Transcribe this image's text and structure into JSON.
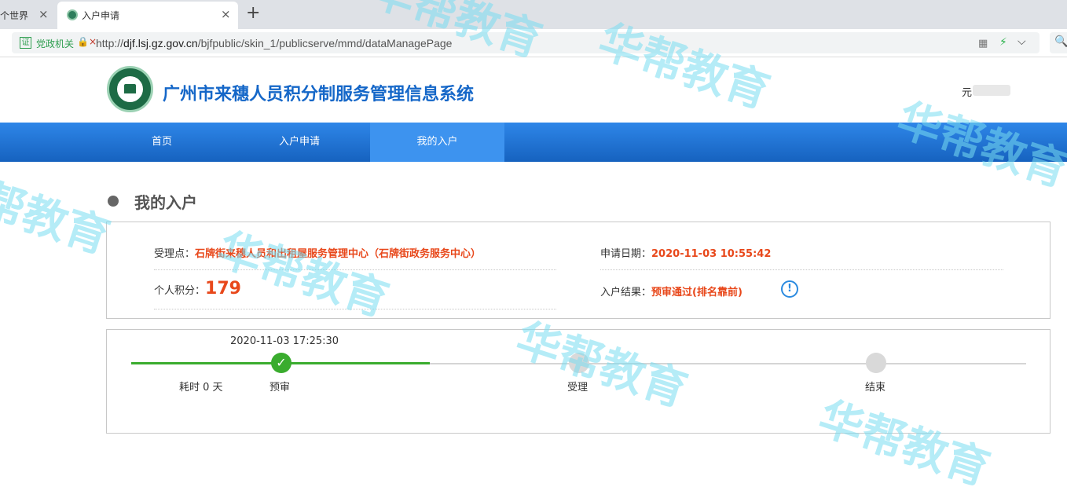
{
  "browser": {
    "tab_prev_title": "个世界",
    "tab_active_title": "入户申请",
    "new_tab": "+",
    "close_glyph": "×",
    "cert_label": "证",
    "cert_text": "党政机关",
    "url_pre": "http://",
    "url_host": "djf.lsj.gz.gov.cn",
    "url_path": "/bjfpublic/skin_1/publicserve/mmd/dataManagePage"
  },
  "header": {
    "title": "广州市来穗人员积分制服务管理信息系统",
    "user": "元"
  },
  "nav": {
    "items": [
      "首页",
      "入户申请",
      "我的入户"
    ],
    "active_index": 2
  },
  "section": {
    "title": "我的入户"
  },
  "info": {
    "acceptance_label": "受理点：",
    "acceptance_value": "石牌街来穗人员和出租屋服务管理中心（石牌街政务服务中心）",
    "date_label": "申请日期：",
    "date_value": "2020-11-03 10:55:42",
    "score_label": "个人积分：",
    "score_value": "179",
    "result_label": "入户结果：",
    "result_value": "预审通过(排名靠前)"
  },
  "progress": {
    "time": "2020-11-03 17:25:30",
    "duration": "耗时 0 天",
    "steps": [
      "预审",
      "受理",
      "结束"
    ],
    "completed_steps": 1
  },
  "watermark": "华帮教育",
  "colors": {
    "brand_blue": "#1567c8",
    "nav_blue": "#1a6fd0",
    "highlight_orange": "#e8481b",
    "progress_green": "#3aac2e"
  }
}
